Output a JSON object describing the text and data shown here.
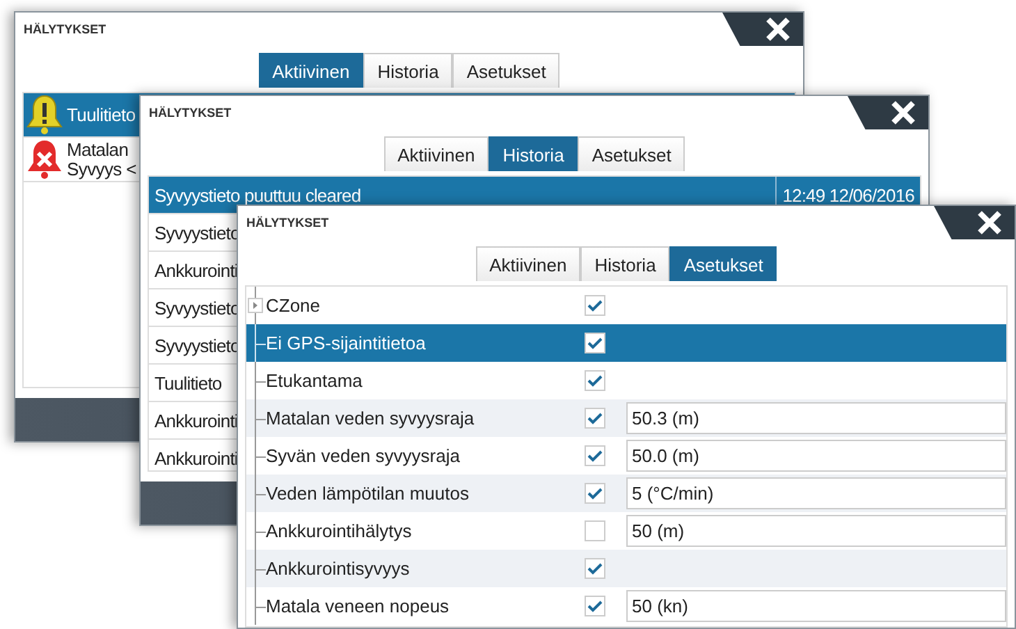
{
  "windows": [
    {
      "kind": "active",
      "title": "HÄLYTYKSET",
      "tabs": [
        {
          "label": "Aktiivinen",
          "selected": true
        },
        {
          "label": "Historia",
          "selected": false
        },
        {
          "label": "Asetukset",
          "selected": false
        }
      ],
      "alarms": [
        {
          "kind": "warning",
          "text": "Tuulitieto",
          "selected": true
        },
        {
          "kind": "alarm",
          "text": "Matalan",
          "detail": "Syvyys <",
          "selected": false
        }
      ]
    },
    {
      "kind": "history",
      "title": "HÄLYTYKSET",
      "tabs": [
        {
          "label": "Aktiivinen",
          "selected": false
        },
        {
          "label": "Historia",
          "selected": true
        },
        {
          "label": "Asetukset",
          "selected": false
        }
      ],
      "events": [
        {
          "text": "Syvyystieto puuttuu cleared",
          "time": "12:49 12/06/2016",
          "selected": true
        },
        {
          "text": "Syvyystieto",
          "selected": false
        },
        {
          "text": "Ankkurointi",
          "selected": false
        },
        {
          "text": "Syvyystieto",
          "selected": false
        },
        {
          "text": "Syvyystieto",
          "selected": false
        },
        {
          "text": "Tuulitieto",
          "selected": false
        },
        {
          "text": "Ankkurointi",
          "selected": false
        },
        {
          "text": "Ankkurointi",
          "selected": false
        }
      ]
    },
    {
      "kind": "settings",
      "title": "HÄLYTYKSET",
      "tabs": [
        {
          "label": "Aktiivinen",
          "selected": false
        },
        {
          "label": "Historia",
          "selected": false
        },
        {
          "label": "Asetukset",
          "selected": true
        }
      ],
      "settings": [
        {
          "label": "CZone",
          "expandable": true,
          "checked": true,
          "selected": false
        },
        {
          "label": "Ei GPS-sijaintitietoa",
          "checked": true,
          "selected": true
        },
        {
          "label": "Etukantama",
          "checked": true,
          "selected": false
        },
        {
          "label": "Matalan veden syvyysraja",
          "checked": true,
          "selected": false,
          "value": "50.3 (m)"
        },
        {
          "label": "Syvän veden syvyysraja",
          "checked": true,
          "selected": false,
          "value": "50.0 (m)"
        },
        {
          "label": "Veden lämpötilan muutos",
          "checked": true,
          "selected": false,
          "value": "5 (°C/min)"
        },
        {
          "label": "Ankkurointihälytys",
          "checked": false,
          "selected": false,
          "value": "50 (m)"
        },
        {
          "label": "Ankkurointisyvyys",
          "checked": true,
          "selected": false
        },
        {
          "label": "Matala veneen nopeus",
          "checked": true,
          "selected": false,
          "value": "50 (kn)"
        }
      ]
    }
  ]
}
